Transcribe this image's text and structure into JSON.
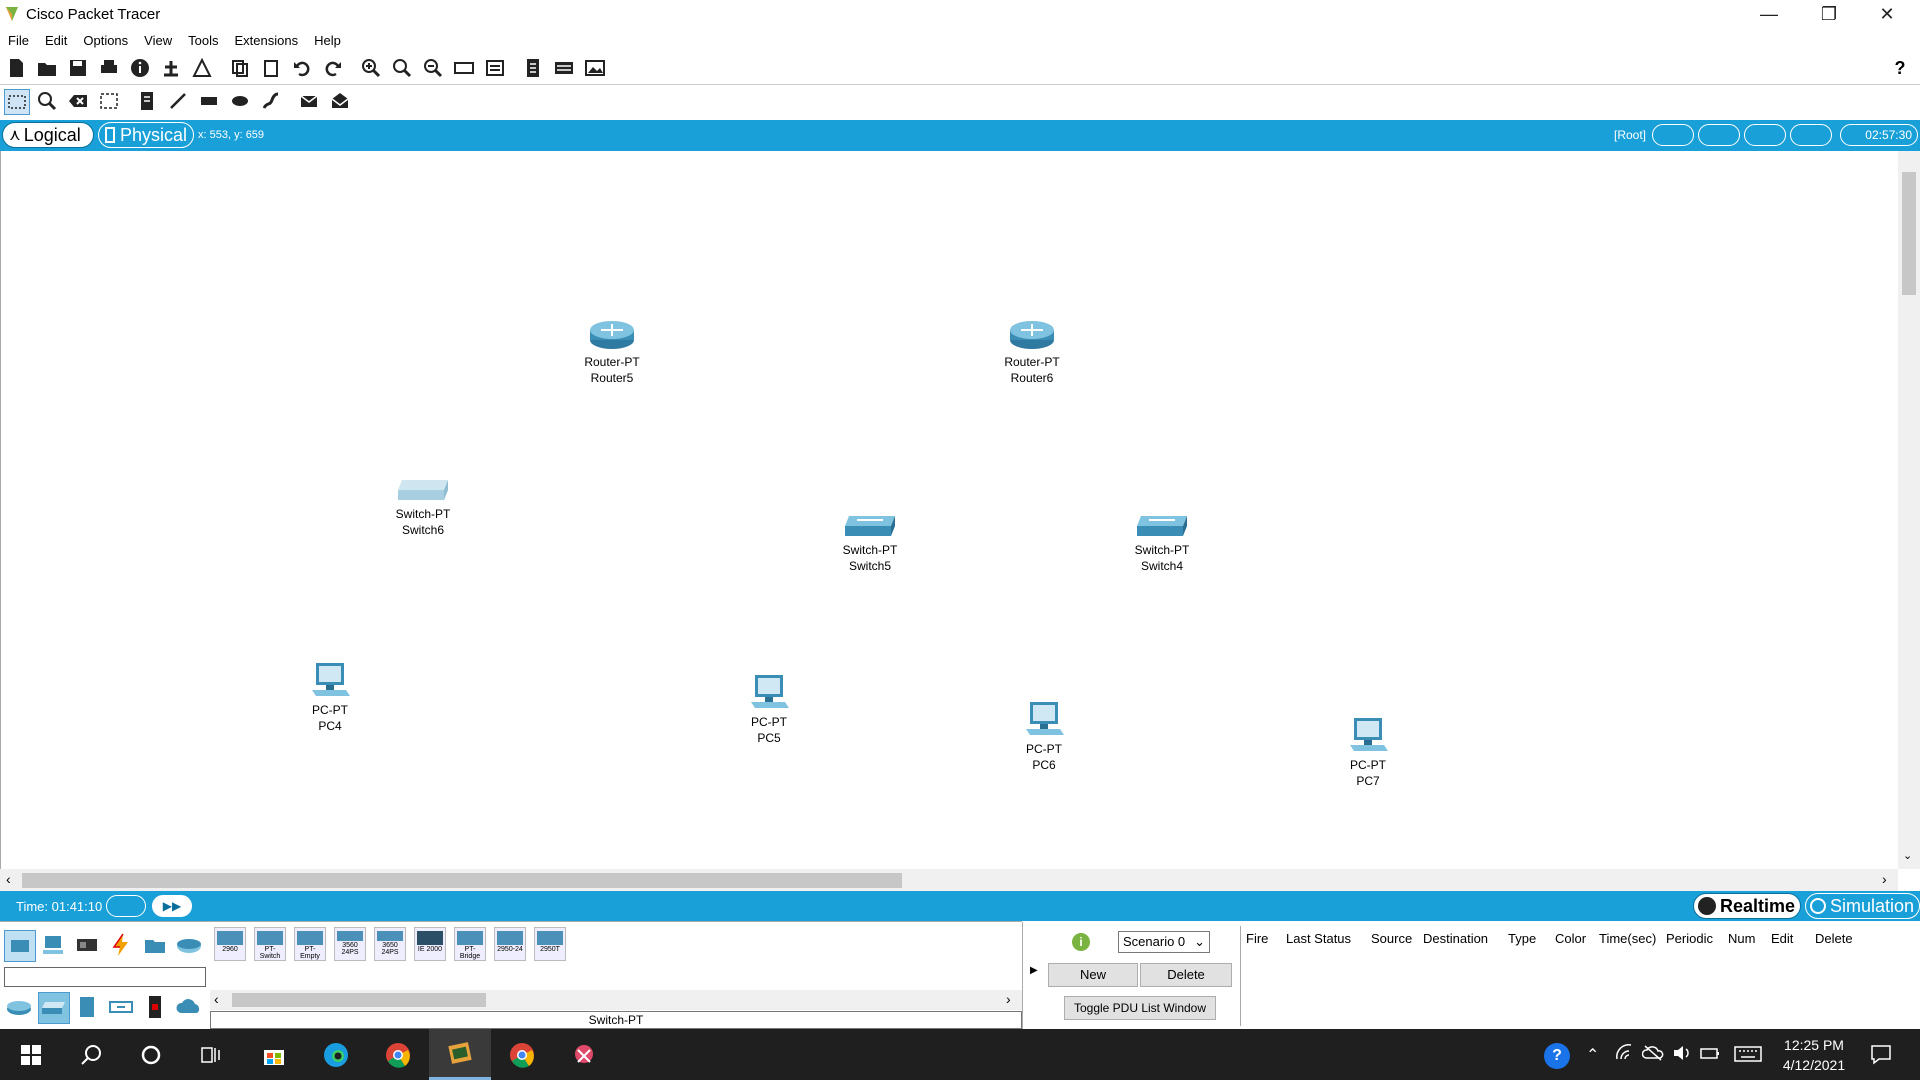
{
  "window": {
    "title": "Cisco Packet Tracer"
  },
  "menu": [
    "File",
    "Edit",
    "Options",
    "View",
    "Tools",
    "Extensions",
    "Help"
  ],
  "workspace": {
    "logical_label": "Logical",
    "physical_label": "Physical",
    "coords": "x: 553, y: 659",
    "root_label": "[Root]",
    "clock": "02:57:30"
  },
  "devices": [
    {
      "type": "router",
      "model": "Router-PT",
      "name": "Router5"
    },
    {
      "type": "router",
      "model": "Router-PT",
      "name": "Router6"
    },
    {
      "type": "switch",
      "model": "Switch-PT",
      "name": "Switch6"
    },
    {
      "type": "switch",
      "model": "Switch-PT",
      "name": "Switch5"
    },
    {
      "type": "switch",
      "model": "Switch-PT",
      "name": "Switch4"
    },
    {
      "type": "pc",
      "model": "PC-PT",
      "name": "PC4"
    },
    {
      "type": "pc",
      "model": "PC-PT",
      "name": "PC5"
    },
    {
      "type": "pc",
      "model": "PC-PT",
      "name": "PC6"
    },
    {
      "type": "pc",
      "model": "PC-PT",
      "name": "PC7"
    }
  ],
  "simbar": {
    "time": "Time: 01:41:10",
    "realtime_label": "Realtime",
    "simulation_label": "Simulation"
  },
  "device_panel": {
    "switch_models": [
      "2960",
      "PT-Switch",
      "PT-Empty",
      "3560 24PS",
      "3650 24PS",
      "IE 2000",
      "PT-Bridge",
      "2950-24",
      "2950T"
    ],
    "selected_name": "Switch-PT"
  },
  "pdu_panel": {
    "scenario": "Scenario 0",
    "new_label": "New",
    "delete_label": "Delete",
    "toggle_label": "Toggle PDU List Window",
    "columns": [
      "Fire",
      "Last Status",
      "Source",
      "Destination",
      "Type",
      "Color",
      "Time(sec)",
      "Periodic",
      "Num",
      "Edit",
      "Delete"
    ]
  },
  "taskbar": {
    "time": "12:25 PM",
    "date": "4/12/2021"
  },
  "colors": {
    "accent": "#1aa0d8",
    "taskbar": "#1f1f1f",
    "device": "#3a8db5"
  }
}
